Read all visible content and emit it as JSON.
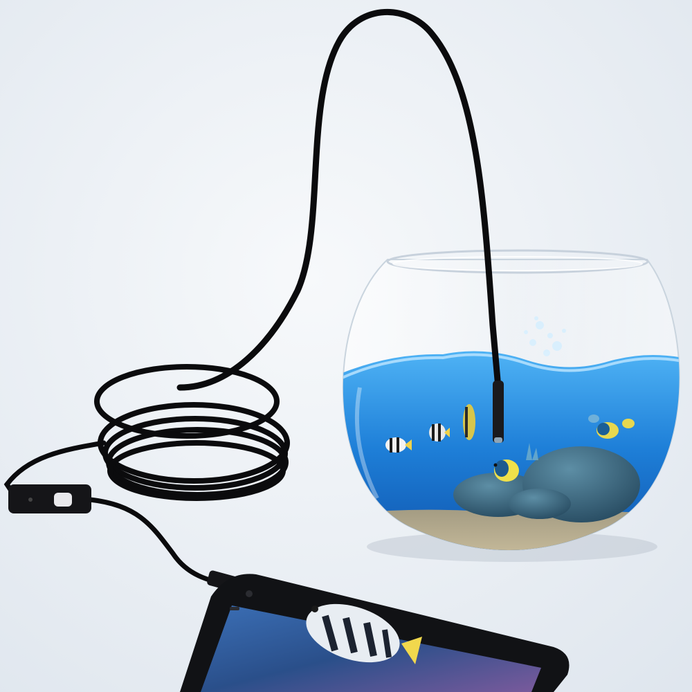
{
  "scene": {
    "background_color": "#eef2f6",
    "objects": [
      "usb-endoscope-camera-cable",
      "coiled-cable",
      "inline-led-dimmer-switch",
      "fishbowl-aquarium",
      "tropical-fish",
      "smartphone-displaying-camera-feed"
    ]
  },
  "colors": {
    "cable": "#0b0b0d",
    "water": "#1e7fd8",
    "water_deep": "#0d4fa8",
    "sand": "#b9ad8e",
    "rock": "#3f6f86",
    "phone_body": "#111215"
  }
}
